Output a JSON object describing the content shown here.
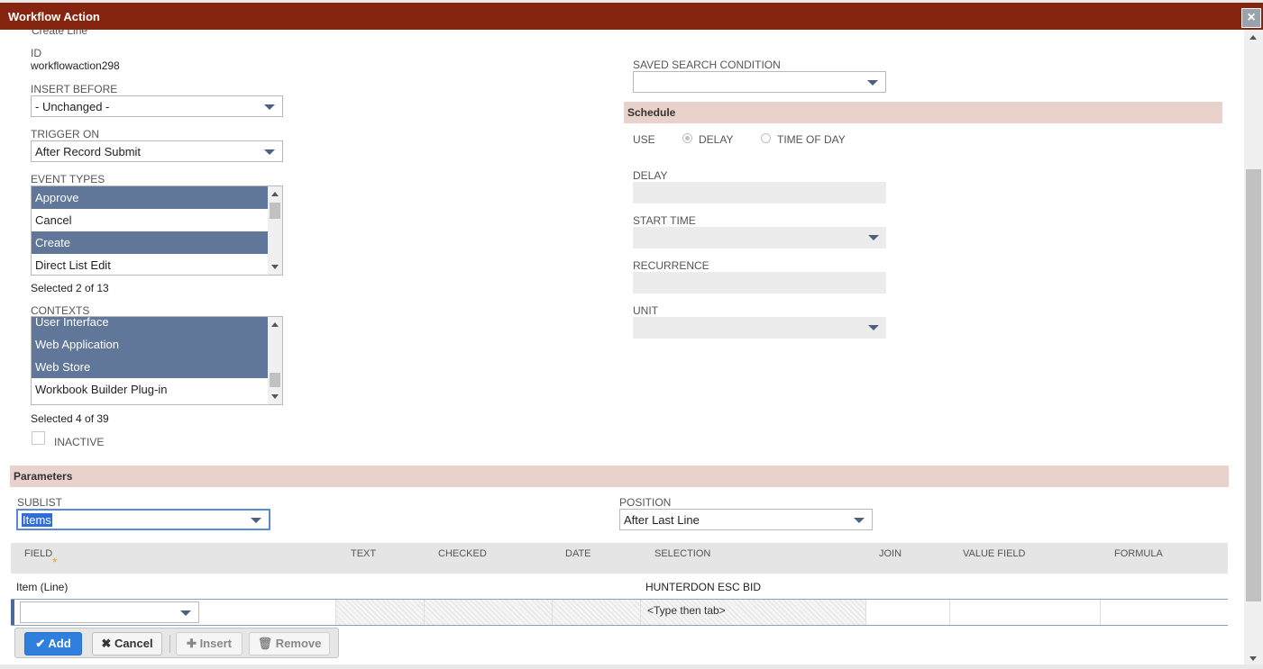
{
  "window": {
    "title": "Workflow Action"
  },
  "header": {
    "top_cut_text": "Create Line"
  },
  "fields": {
    "id_label": "ID",
    "id_value": "workflowaction298",
    "insert_before_label": "INSERT BEFORE",
    "insert_before_value": "- Unchanged -",
    "trigger_on_label": "TRIGGER ON",
    "trigger_on_value": "After Record Submit",
    "event_types_label": "EVENT TYPES",
    "event_types_options": [
      {
        "label": "Approve",
        "selected": true
      },
      {
        "label": "Cancel",
        "selected": false
      },
      {
        "label": "Create",
        "selected": true
      },
      {
        "label": "Direct List Edit",
        "selected": false
      }
    ],
    "event_types_count": "Selected 2 of 13",
    "contexts_label": "CONTEXTS",
    "contexts_options": [
      {
        "label": "User Interface",
        "selected": true
      },
      {
        "label": "Web Application",
        "selected": true
      },
      {
        "label": "Web Store",
        "selected": true
      },
      {
        "label": "Workbook Builder Plug-in",
        "selected": false
      }
    ],
    "contexts_count": "Selected 4 of 39",
    "inactive_label": "INACTIVE",
    "saved_search_label": "SAVED SEARCH CONDITION",
    "saved_search_value": ""
  },
  "schedule": {
    "section_title": "Schedule",
    "use_label": "USE",
    "delay_option": "DELAY",
    "time_of_day_option": "TIME OF DAY",
    "delay_label": "DELAY",
    "start_time_label": "START TIME",
    "recurrence_label": "RECURRENCE",
    "unit_label": "UNIT"
  },
  "parameters": {
    "section_title": "Parameters",
    "sublist_label": "SUBLIST",
    "sublist_value": "Items",
    "position_label": "POSITION",
    "position_value": "After Last Line",
    "columns": [
      "FIELD",
      "TEXT",
      "CHECKED",
      "DATE",
      "SELECTION",
      "JOIN",
      "VALUE FIELD",
      "FORMULA"
    ],
    "required_marker": "*",
    "rows": [
      {
        "field": "Item (Line)",
        "selection": "HUNTERDON ESC BID"
      }
    ],
    "edit_row_placeholder": "<Type then tab>"
  },
  "buttons": {
    "add": "Add",
    "cancel": "Cancel",
    "insert": "Insert",
    "remove": "Remove"
  },
  "icons": {
    "close": "close-icon",
    "check": "check-icon",
    "x": "x-icon",
    "plus": "plus-icon",
    "trash": "trash-icon"
  },
  "colors": {
    "titlebar": "#85240f",
    "section": "#e9d2cc",
    "selected_option": "#607799",
    "primary_button": "#2f7fde"
  }
}
